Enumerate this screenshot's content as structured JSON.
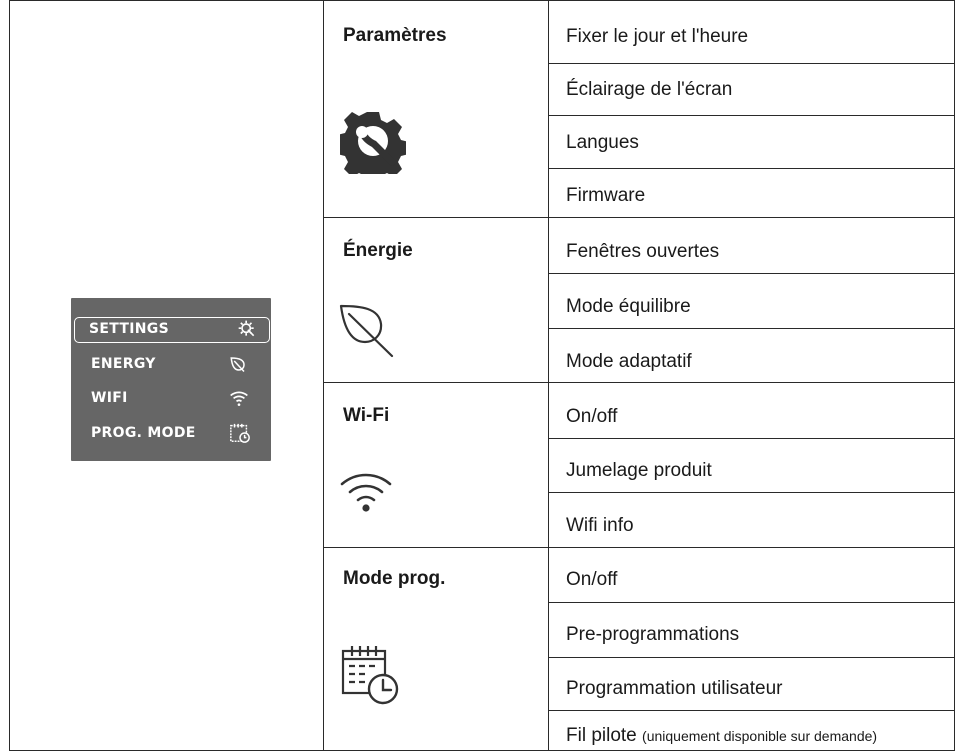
{
  "device": {
    "items": [
      {
        "label": "SETTINGS",
        "icon": "gear-wrench-icon",
        "selected": true
      },
      {
        "label": "ENERGY",
        "icon": "leaf-icon",
        "selected": false
      },
      {
        "label": "WIFI",
        "icon": "wifi-icon",
        "selected": false
      },
      {
        "label": "PROG. MODE",
        "icon": "calendar-clock-icon",
        "selected": false
      }
    ]
  },
  "categories": [
    {
      "title": "Paramètres",
      "icon": "gear-wrench-icon",
      "options": [
        "Fixer le jour et l'heure",
        "Éclairage de l'écran",
        "Langues",
        "Firmware"
      ]
    },
    {
      "title": "Énergie",
      "icon": "leaf-icon",
      "options": [
        "Fenêtres ouvertes",
        "Mode équilibre",
        "Mode adaptatif"
      ]
    },
    {
      "title": "Wi-Fi",
      "icon": "wifi-icon",
      "options": [
        "On/off",
        "Jumelage produit",
        "Wifi info"
      ]
    },
    {
      "title": "Mode prog.",
      "icon": "calendar-clock-icon",
      "options": [
        "On/off",
        "Pre-programmations",
        "Programmation utilisateur"
      ],
      "last_option": {
        "main": "Fil pilote",
        "note": "(uniquement disponible sur demande)"
      }
    }
  ]
}
